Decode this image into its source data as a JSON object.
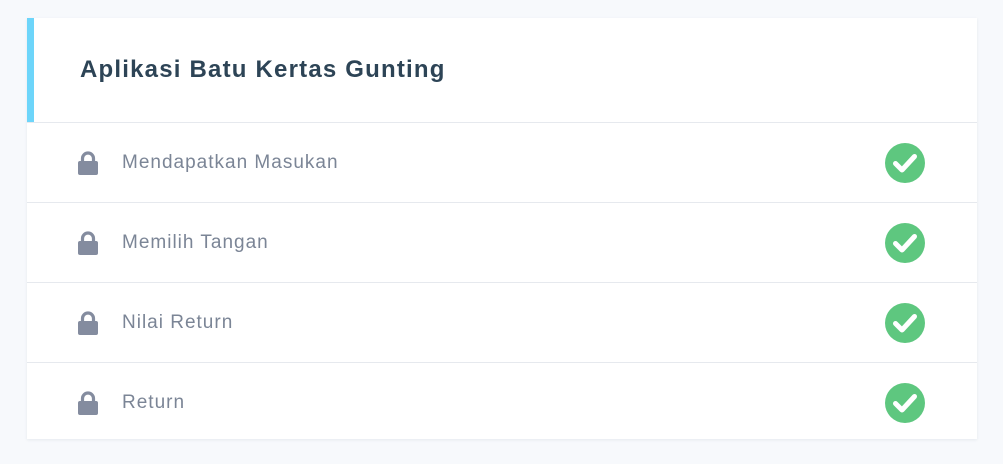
{
  "course": {
    "title": "Aplikasi Batu Kertas Gunting"
  },
  "lessons": [
    {
      "label": "Mendapatkan Masukan",
      "locked_icon": "lock-icon",
      "status_icon": "check-circle-icon"
    },
    {
      "label": "Memilih Tangan",
      "locked_icon": "lock-icon",
      "status_icon": "check-circle-icon"
    },
    {
      "label": "Nilai Return",
      "locked_icon": "lock-icon",
      "status_icon": "check-circle-icon"
    },
    {
      "label": "Return",
      "locked_icon": "lock-icon",
      "status_icon": "check-circle-icon"
    }
  ],
  "colors": {
    "accent": "#6dd5fa",
    "title": "#2d4456",
    "lesson_text": "#7b8596",
    "lock": "#848c9f",
    "check": "#5ec77f",
    "page_bg": "#f7f9fc"
  }
}
